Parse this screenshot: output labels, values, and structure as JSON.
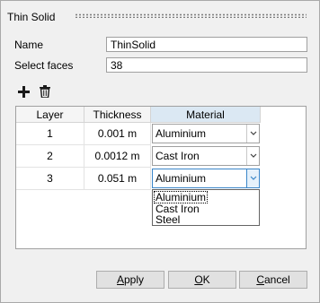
{
  "dialog": {
    "title": "Thin Solid"
  },
  "form": {
    "name_label": "Name",
    "name_value": "ThinSolid",
    "faces_label": "Select faces",
    "faces_value": "38"
  },
  "toolbar": {
    "add_icon": "plus-icon",
    "delete_icon": "trash-icon"
  },
  "table": {
    "headers": [
      "Layer",
      "Thickness",
      "Material"
    ],
    "rows": [
      {
        "layer": "1",
        "thickness": "0.001 m",
        "material": "Aluminium"
      },
      {
        "layer": "2",
        "thickness": "0.0012 m",
        "material": "Cast Iron"
      },
      {
        "layer": "3",
        "thickness": "0.051 m",
        "material": "Aluminium"
      }
    ]
  },
  "material_dropdown": {
    "options": [
      "Aluminium",
      "Cast Iron",
      "Steel"
    ],
    "selected": "Aluminium"
  },
  "buttons": {
    "apply_prefix": "",
    "apply_mnemonic": "A",
    "apply_rest": "pply",
    "ok_prefix": "",
    "ok_mnemonic": "O",
    "ok_rest": "K",
    "cancel_prefix": "",
    "cancel_mnemonic": "C",
    "cancel_rest": "ancel"
  },
  "colors": {
    "accent": "#3a86c9",
    "header_active": "#dbe8f3"
  }
}
